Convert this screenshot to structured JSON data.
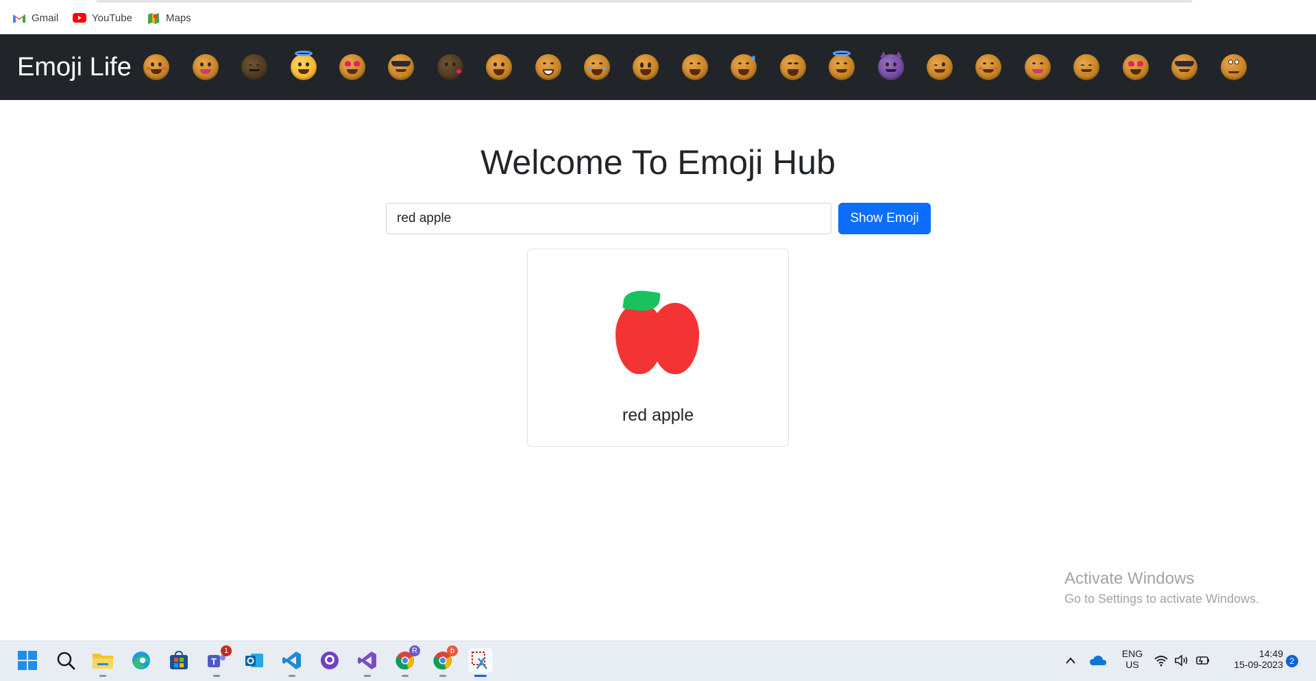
{
  "bookmarks": {
    "items": [
      {
        "label": "Gmail",
        "icon": "gmail-icon"
      },
      {
        "label": "YouTube",
        "icon": "youtube-icon"
      },
      {
        "label": "Maps",
        "icon": "maps-icon"
      }
    ]
  },
  "navbar": {
    "brand": "Emoji Life",
    "emojis": [
      "smiling-face-icon",
      "face-savoring-food-icon",
      "relieved-face-dark-icon",
      "halo-face-icon",
      "heart-eyes-face-icon",
      "sunglasses-face-icon",
      "kissing-face-dark-icon",
      "grinning-face-icon",
      "beaming-face-icon",
      "tears-of-joy-face-icon",
      "grinning-big-eyes-face-icon",
      "grinning-smiling-eyes-face-icon",
      "sweat-smile-face-icon",
      "squinting-laugh-face-icon",
      "halo-face-icon",
      "devil-face-icon",
      "winking-face-icon",
      "smiling-face-icon",
      "face-savoring-food-icon",
      "relieved-face-icon",
      "heart-eyes-face-icon",
      "sunglasses-face-icon",
      "rolling-eyes-face-icon"
    ]
  },
  "main": {
    "title": "Welcome To Emoji Hub",
    "search": {
      "value": "red apple",
      "button": "Show Emoji"
    },
    "result": {
      "emoji_icon": "red-apple-icon",
      "label": "red apple"
    }
  },
  "watermark": {
    "line1": "Activate Windows",
    "line2": "Go to Settings to activate Windows."
  },
  "taskbar": {
    "apps": [
      {
        "name": "start-icon"
      },
      {
        "name": "search-icon"
      },
      {
        "name": "file-explorer-icon"
      },
      {
        "name": "edge-icon"
      },
      {
        "name": "store-icon"
      },
      {
        "name": "teams-icon",
        "badge": "1"
      },
      {
        "name": "outlook-icon"
      },
      {
        "name": "vscode-icon"
      },
      {
        "name": "github-icon"
      },
      {
        "name": "visual-studio-icon"
      },
      {
        "name": "chrome-profile-r-icon",
        "badge": "R"
      },
      {
        "name": "chrome-profile-b-icon",
        "badge": "b"
      },
      {
        "name": "snipping-tool-icon"
      }
    ],
    "tray": {
      "lang_line1": "ENG",
      "lang_line2": "US",
      "time": "14:49",
      "date": "15-09-2023",
      "notification_count": "2"
    }
  },
  "colors": {
    "navbar_bg": "#212529",
    "primary_button": "#0d6efd",
    "apple_red": "#f33334",
    "apple_leaf": "#19c25f"
  }
}
